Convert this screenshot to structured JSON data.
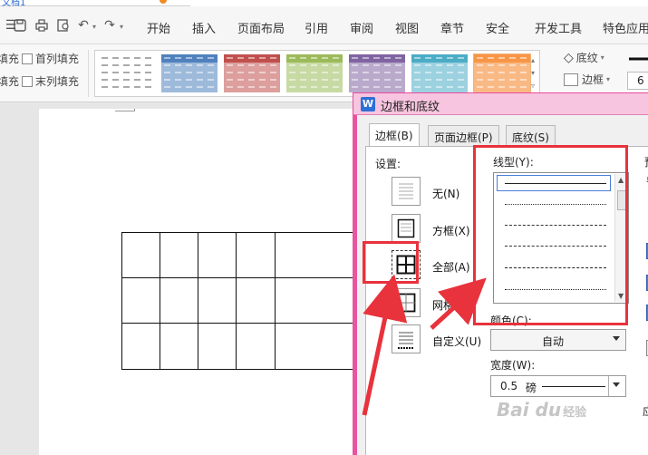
{
  "colors": {
    "accent_pink": "#e8559f",
    "dialog_titlebar": "#f7c5df",
    "highlight_red": "#e8323c",
    "link_blue": "#2b6cd6"
  },
  "titlebar": {
    "tab_fragment": "文档1"
  },
  "menu": {
    "tabs": [
      "开始",
      "插入",
      "页面布局",
      "引用",
      "审阅",
      "视图",
      "章节",
      "安全",
      "开发工具",
      "特色应用"
    ]
  },
  "ribbon": {
    "checkboxes": {
      "left_fill_1": "填充",
      "left_fill_2": "填充",
      "first_col_fill": "首列填充",
      "last_col_fill": "末列填充"
    },
    "gallery_colors": [
      "#ffffff",
      "#4f81bd",
      "#c0504d",
      "#9bbb59",
      "#8064a2",
      "#4bacc6",
      "#f79646"
    ],
    "shading_label": "底纹",
    "border_label": "边框",
    "border_width_value": "6"
  },
  "dialog": {
    "title": "边框和底纹",
    "logo": "W",
    "tabs": [
      "边框(B)",
      "页面边框(P)",
      "底纹(S)"
    ],
    "settings_label": "设置:",
    "settings": [
      {
        "label": "无(N)",
        "icon": "none-border-icon"
      },
      {
        "label": "方框(X)",
        "icon": "box-border-icon"
      },
      {
        "label": "全部(A)",
        "icon": "all-borders-icon"
      },
      {
        "label": "网格(D)",
        "icon": "grid-border-icon"
      },
      {
        "label": "自定义(U)",
        "icon": "custom-border-icon"
      }
    ],
    "line_style_label": "线型(Y):",
    "color_label": "颜色(C):",
    "color_value": "自动",
    "width_label": "宽度(W):",
    "width_value": "0.5",
    "width_unit": "磅",
    "preview_label_fragment": "预",
    "preview_sub_fragment": "单",
    "apply_label_fragment": "应"
  },
  "watermark": {
    "text": "Bai du",
    "sub": "经验"
  }
}
